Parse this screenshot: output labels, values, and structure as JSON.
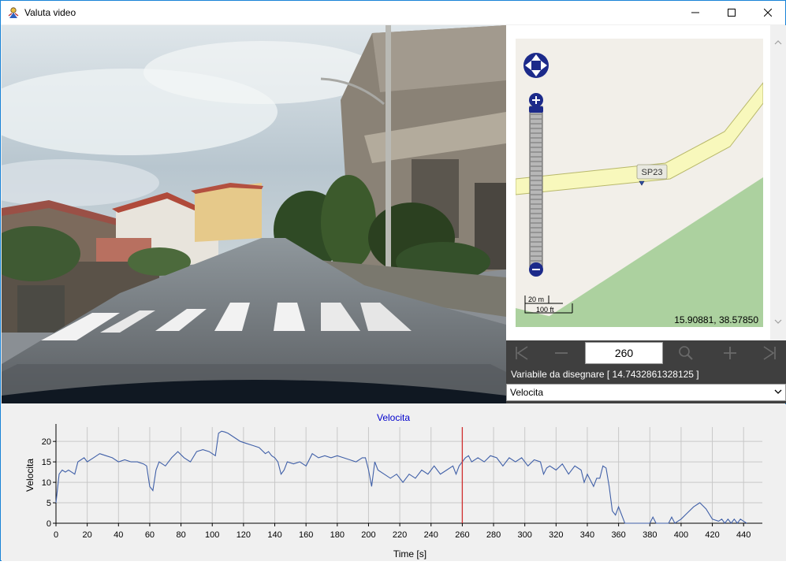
{
  "window": {
    "title": "Valuta video",
    "controls": {
      "minimize": "minimize-icon",
      "maximize": "maximize-icon",
      "close": "close-icon"
    }
  },
  "map": {
    "road_label": "SP23",
    "scale_m": "20 m",
    "scale_ft": "100 ft",
    "coordinates": "15.90881, 38.57850"
  },
  "player": {
    "frame_value": "260",
    "buttons": [
      "first-frame-icon",
      "minus-icon",
      "zoom-icon",
      "plus-icon",
      "last-frame-icon"
    ]
  },
  "variable": {
    "label": "Variabile da disegnare [ 14.7432861328125 ]",
    "selected": "Velocita"
  },
  "colors": {
    "accent": "#1883d7",
    "series": "#4060a8",
    "marker": "#d03030",
    "map_road": "#f8f8bc",
    "map_park": "#acd19f"
  },
  "chart_data": {
    "type": "line",
    "title": "Velocita",
    "xlabel": "Time [s]",
    "ylabel": "Velocita",
    "xlim": [
      0,
      452
    ],
    "ylim": [
      0,
      23.5
    ],
    "xticks": [
      0,
      20,
      40,
      60,
      80,
      100,
      120,
      140,
      160,
      180,
      200,
      220,
      240,
      260,
      280,
      300,
      320,
      340,
      360,
      380,
      400,
      420,
      440
    ],
    "yticks": [
      0,
      5,
      10,
      15,
      20
    ],
    "marker_x": 260,
    "grid": true,
    "series": [
      {
        "x": [
          0,
          2,
          4,
          6,
          8,
          10,
          12,
          14,
          16,
          18,
          20,
          24,
          28,
          32,
          36,
          40,
          44,
          48,
          52,
          56,
          58,
          60,
          62,
          64,
          66,
          70,
          74,
          78,
          82,
          86,
          90,
          94,
          98,
          100,
          102,
          104,
          106,
          108,
          110,
          114,
          118,
          122,
          126,
          130,
          134,
          136,
          138,
          140,
          142,
          144,
          146,
          148,
          152,
          156,
          160,
          164,
          168,
          172,
          176,
          180,
          184,
          188,
          192,
          196,
          198,
          200,
          202,
          204,
          206,
          210,
          214,
          218,
          220,
          222,
          226,
          230,
          234,
          238,
          242,
          246,
          250,
          254,
          256,
          258,
          260,
          262,
          264,
          266,
          270,
          274,
          278,
          282,
          286,
          290,
          294,
          298,
          302,
          306,
          310,
          312,
          314,
          316,
          320,
          324,
          328,
          332,
          336,
          338,
          340,
          344,
          346,
          348,
          350,
          352,
          354,
          356,
          358,
          360,
          364,
          368,
          372,
          376,
          380,
          382,
          384,
          388,
          392,
          394,
          396,
          400,
          404,
          408,
          412,
          416,
          420,
          424,
          426,
          428,
          430,
          432,
          434,
          436,
          438,
          440,
          442
        ],
        "y": [
          5,
          12,
          13,
          12.5,
          13,
          12.5,
          12,
          15,
          15.5,
          16,
          15,
          16,
          17,
          16.5,
          16,
          15,
          15.5,
          15,
          15,
          14.5,
          14,
          9,
          8,
          13,
          15,
          14,
          16,
          17.5,
          16,
          15,
          17.5,
          18,
          17.5,
          17,
          16.5,
          22,
          22.5,
          22.3,
          22,
          21,
          20,
          19.5,
          19,
          18.5,
          17,
          17.5,
          16.5,
          16,
          15,
          12,
          13,
          15,
          14.5,
          15,
          14,
          17,
          16,
          16.5,
          16,
          16.5,
          16,
          15.5,
          15,
          16,
          16,
          13,
          9,
          15,
          13,
          12,
          11,
          12,
          11,
          10,
          12,
          11,
          13,
          12,
          14,
          12,
          13,
          14,
          12,
          14,
          15,
          16,
          16.5,
          15,
          16,
          15,
          16.5,
          16,
          14,
          16,
          15,
          16,
          14,
          15.5,
          15,
          12,
          13.5,
          14,
          13,
          14.5,
          12,
          14,
          13,
          10,
          12,
          9,
          11,
          11,
          14,
          13.5,
          9,
          3,
          2,
          4,
          0,
          0,
          0,
          0,
          0,
          1.5,
          0,
          0,
          0,
          1.5,
          0,
          1,
          2.5,
          4,
          5,
          3.5,
          1,
          0.5,
          1,
          0,
          1,
          0,
          1,
          0,
          1,
          0.5,
          0
        ]
      }
    ]
  }
}
